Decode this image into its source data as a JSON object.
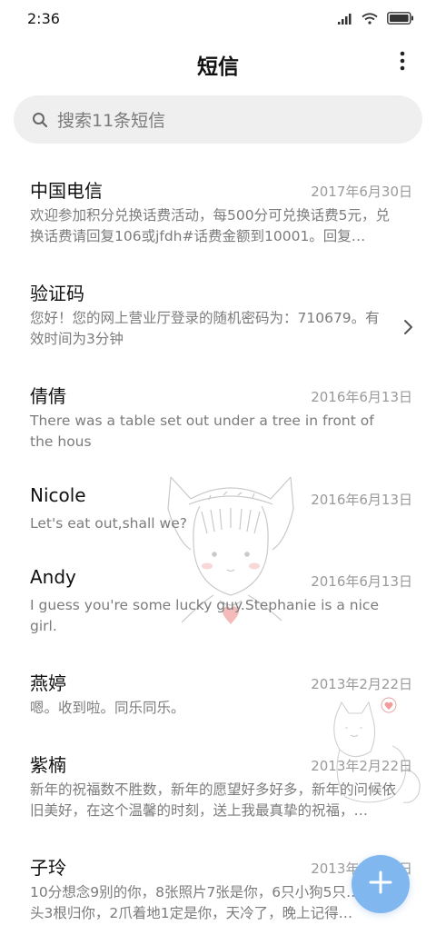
{
  "status_bar": {
    "time": "2:36",
    "icons": [
      "signal-icon",
      "wifi-icon",
      "battery-icon"
    ]
  },
  "header": {
    "title": "短信",
    "more_icon": "more-vertical-icon"
  },
  "search": {
    "placeholder": "搜索11条短信",
    "icon": "search-icon"
  },
  "messages": [
    {
      "name": "中国电信",
      "date": "2017年6月30日",
      "preview": "欢迎参加积分兑换话费活动，每500分可兑换话费5元，兑换话费请回复106或jfdh#话费金额到10001。回复…"
    },
    {
      "name": "验证码",
      "date": "",
      "preview": "您好！您的网上营业厅登录的随机密码为：710679。有效时间为3分钟"
    },
    {
      "name": "倩倩",
      "date": "2016年6月13日",
      "preview": "There was a table set out under a tree in front of the hous"
    },
    {
      "name": "Nicole",
      "date": "2016年6月13日",
      "preview": "Let's eat out,shall we?"
    },
    {
      "name": "Andy",
      "date": "2016年6月13日",
      "preview": "I guess you're some lucky guy.Stephanie is a nice girl."
    },
    {
      "name": "燕婷",
      "date": "2013年2月22日",
      "preview": "嗯。收到啦。同乐同乐。"
    },
    {
      "name": "紫楠",
      "date": "2013年2月22日",
      "preview": "新年的祝福数不胜数，新年的愿望好多好多，新年的问候依旧美好，在这个温馨的时刻，送上我最真挚的祝福，…"
    },
    {
      "name": "子玲",
      "date": "2013年2月22日",
      "preview": "10分想念9别的你，8张照片7张是你，6只小狗5只…4根骨头3根归你，2爪着地1定是你，天冷了，晚上记得…"
    }
  ],
  "fab": {
    "icon": "plus-icon"
  },
  "colors": {
    "accent": "#7fb7ee",
    "secondary_text": "#7b7b7b",
    "search_bg": "#efefef"
  }
}
